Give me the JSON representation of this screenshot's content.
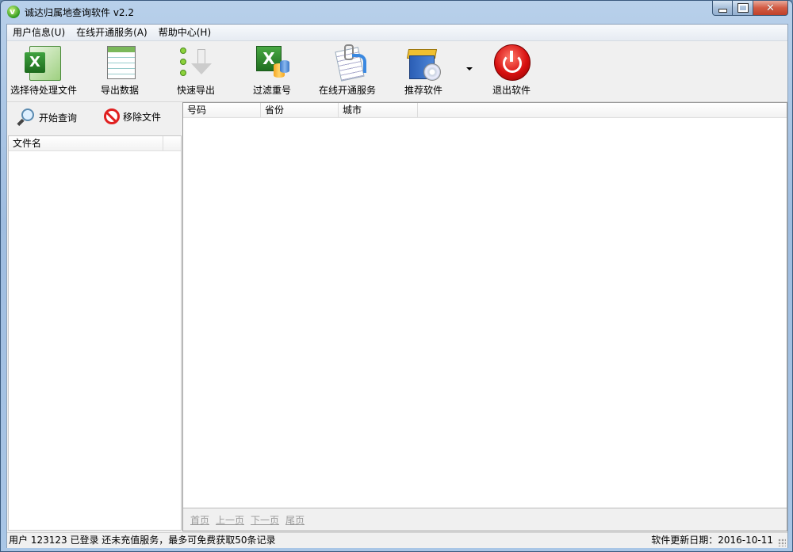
{
  "window": {
    "title": "诚达归属地查询软件 v2.2",
    "icon": "app-leaf-icon"
  },
  "menubar": {
    "items": [
      "用户信息(U)",
      "在线开通服务(A)",
      "帮助中心(H)"
    ]
  },
  "toolbar": {
    "buttons": [
      {
        "label": "选择待处理文件",
        "icon": "excel-icon"
      },
      {
        "label": "导出数据",
        "icon": "table-sheet-icon"
      },
      {
        "label": "快速导出",
        "icon": "download-arrow-icon"
      },
      {
        "label": "过滤重号",
        "icon": "excel-filter-icon"
      },
      {
        "label": "在线开通服务",
        "icon": "document-service-icon"
      },
      {
        "label": "推荐软件",
        "icon": "software-box-icon"
      },
      {
        "label": "退出软件",
        "icon": "power-icon"
      }
    ]
  },
  "left_panel": {
    "start_query_label": "开始查询",
    "remove_file_label": "移除文件",
    "file_list_header": "文件名"
  },
  "results": {
    "columns": [
      "号码",
      "省份",
      "城市"
    ],
    "rows": []
  },
  "pager": {
    "first": "首页",
    "prev": "上一页",
    "next": "下一页",
    "last": "尾页"
  },
  "status": {
    "left": "用户 123123 已登录 还未充值服务，最多可免费获取50条记录",
    "right": "软件更新日期：2016-10-11"
  },
  "colors": {
    "title_bar": "#a9c6e6",
    "close_button": "#c0412a",
    "exit_red": "#d81010",
    "pager_link": "#9a9a9a"
  }
}
